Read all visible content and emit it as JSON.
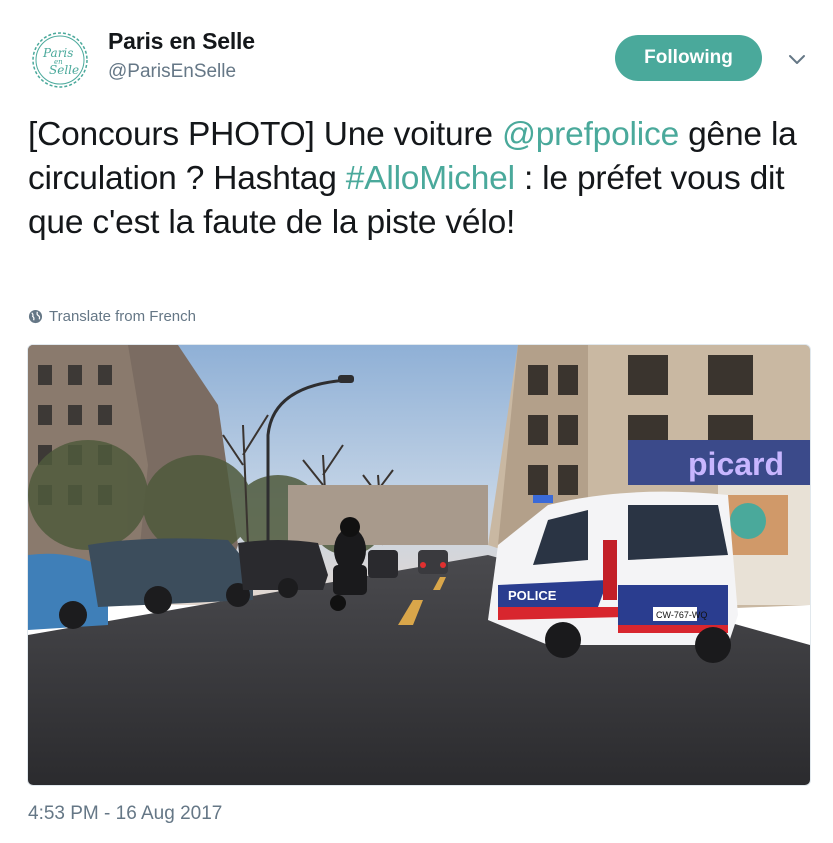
{
  "account": {
    "name": "Paris en Selle",
    "handle": "@ParisEnSelle",
    "avatar_logo_text": "Paris en Selle"
  },
  "follow_button": {
    "label": "Following"
  },
  "tweet": {
    "text_parts": [
      {
        "text": "[Concours PHOTO] Une voiture ",
        "type": "text"
      },
      {
        "text": "@prefpolice",
        "type": "mention"
      },
      {
        "text": " gêne la circulation ? Hashtag ",
        "type": "text"
      },
      {
        "text": "#AlloMichel",
        "type": "hashtag"
      },
      {
        "text": " : le préfet vous dit que c'est la faute de la piste vélo!",
        "type": "text"
      }
    ],
    "translate_label": "Translate from French",
    "timestamp": "4:53 PM - 16 Aug 2017"
  },
  "photo": {
    "store_sign": "picard",
    "police_label": "POLICE",
    "plate": "CW-767-WQ"
  },
  "colors": {
    "accent": "#4aa99b",
    "secondary_text": "#657786",
    "primary_text": "#14171a"
  },
  "icons": {
    "dropdown": "chevron-down-icon",
    "translate": "globe-icon"
  }
}
